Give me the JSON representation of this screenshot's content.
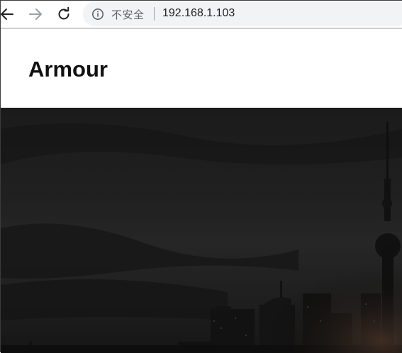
{
  "browser": {
    "security_label": "不安全",
    "url": "192.168.1.103"
  },
  "site": {
    "brand": "Armour"
  },
  "icons": {
    "back": "arrow-left-icon",
    "forward": "arrow-right-icon",
    "reload": "reload-icon",
    "info": "info-icon"
  },
  "colors": {
    "omnibox_bg": "#f1f3f4",
    "hero_bg": "#1c1c1c"
  }
}
